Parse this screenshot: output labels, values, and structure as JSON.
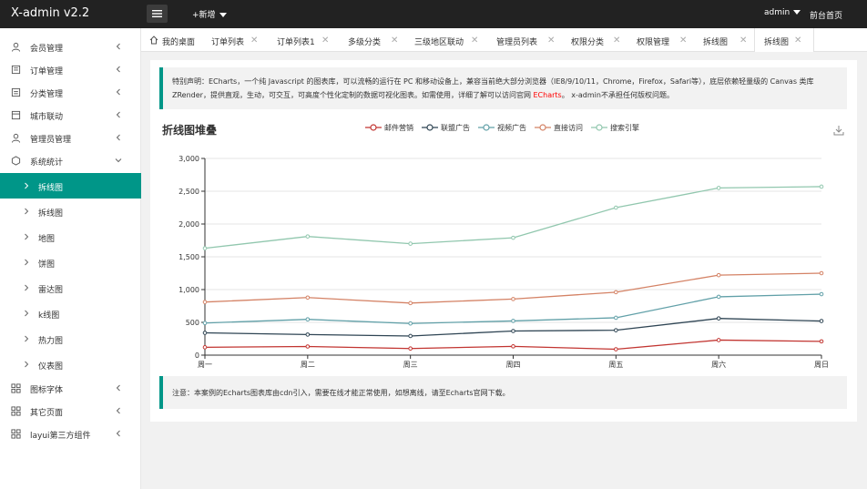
{
  "header": {
    "logo": "X-admin v2.2",
    "add_label": "+新增",
    "user": "admin",
    "home": "前台首页"
  },
  "sidebar": {
    "items": [
      {
        "label": "会员管理",
        "icon": "user-icon"
      },
      {
        "label": "订单管理",
        "icon": "order-icon"
      },
      {
        "label": "分类管理",
        "icon": "category-icon"
      },
      {
        "label": "城市联动",
        "icon": "city-icon"
      },
      {
        "label": "管理员管理",
        "icon": "admin-icon"
      },
      {
        "label": "系统统计",
        "icon": "stats-icon"
      }
    ],
    "subitems": [
      {
        "label": "拆线图",
        "active": true
      },
      {
        "label": "拆线图",
        "active": false
      },
      {
        "label": "地图",
        "active": false
      },
      {
        "label": "饼图",
        "active": false
      },
      {
        "label": "雷达图",
        "active": false
      },
      {
        "label": "k线图",
        "active": false
      },
      {
        "label": "热力图",
        "active": false
      },
      {
        "label": "仪表图",
        "active": false
      }
    ],
    "bottom_items": [
      {
        "label": "图标字体",
        "icon": "grid-icon"
      },
      {
        "label": "其它页面",
        "icon": "grid-icon"
      },
      {
        "label": "layui第三方组件",
        "icon": "grid-icon"
      }
    ]
  },
  "tabs": [
    {
      "label": "我的桌面",
      "home": true
    },
    {
      "label": "订单列表"
    },
    {
      "label": "订单列表1"
    },
    {
      "label": "多级分类"
    },
    {
      "label": "三级地区联动"
    },
    {
      "label": "管理员列表"
    },
    {
      "label": "权限分类"
    },
    {
      "label": "权限管理"
    },
    {
      "label": "拆线图"
    },
    {
      "label": "拆线图",
      "active": true
    }
  ],
  "notice": {
    "text1": "特别声明：ECharts，一个纯 Javascript 的图表库，可以流畅的运行在 PC 和移动设备上，兼容当前绝大部分浏览器（IE8/9/10/11，Chrome，Firefox，Safari等），底层依赖轻量级的 Canvas 类库 ZRender，提供直观，生动，可交互，可高度个性化定制的数据可视化图表。如需使用，详细了解可以访问官网 ",
    "link": "ECharts",
    "text2": "。 x-admin不承担任何版权问题。"
  },
  "footnote": "注意：本案例的Echarts图表库由cdn引入，需要在线才能正常使用，如想离线，请至Echarts官网下载。",
  "chart_data": {
    "type": "line",
    "title": "折线图堆叠",
    "categories": [
      "周一",
      "周二",
      "周三",
      "周四",
      "周五",
      "周六",
      "周日"
    ],
    "yticks": [
      "0",
      "500",
      "1,000",
      "1,500",
      "2,000",
      "2,500",
      "3,000"
    ],
    "ylim": [
      0,
      3000
    ],
    "stacked": true,
    "grid": true,
    "legend_position": "top-center",
    "series": [
      {
        "name": "邮件营销",
        "color": "#c23531",
        "values": [
          120,
          132,
          101,
          134,
          90,
          230,
          210
        ]
      },
      {
        "name": "联盟广告",
        "color": "#2f4554",
        "values": [
          340,
          314,
          292,
          368,
          380,
          560,
          520
        ]
      },
      {
        "name": "视频广告",
        "color": "#61a0a8",
        "values": [
          490,
          546,
          483,
          522,
          570,
          890,
          930
        ]
      },
      {
        "name": "直接访问",
        "color": "#d48265",
        "values": [
          810,
          878,
          794,
          856,
          960,
          1220,
          1250
        ]
      },
      {
        "name": "搜索引擎",
        "color": "#91c7ae",
        "values": [
          1630,
          1810,
          1700,
          1790,
          2250,
          2550,
          2570
        ]
      }
    ]
  },
  "colors": {
    "accent": "#009688",
    "header_bg": "#222222"
  }
}
